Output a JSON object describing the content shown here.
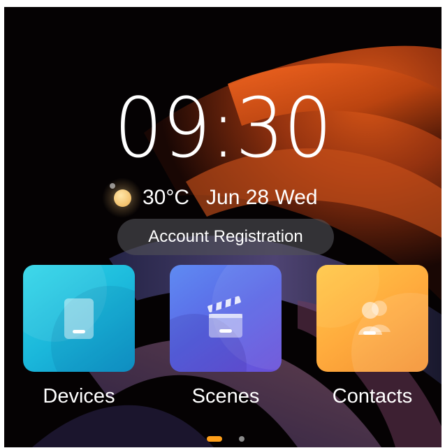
{
  "clock": {
    "time": "09:30"
  },
  "weather": {
    "icon": "sun-icon",
    "temperature": "30°C",
    "date": "Jun 28 Wed"
  },
  "account": {
    "button_label": "Account Registration"
  },
  "apps": [
    {
      "label": "Devices",
      "icon": "tablet-icon",
      "color": "#1ab6da"
    },
    {
      "label": "Scenes",
      "icon": "clapperboard-icon",
      "color": "#5a67e6"
    },
    {
      "label": "Contacts",
      "icon": "contacts-icon",
      "color": "#ffab3d"
    }
  ],
  "pager": {
    "pages": 2,
    "active_page": 1,
    "active_color": "#ff9f1a",
    "inactive_color": "#8a8a8a"
  }
}
